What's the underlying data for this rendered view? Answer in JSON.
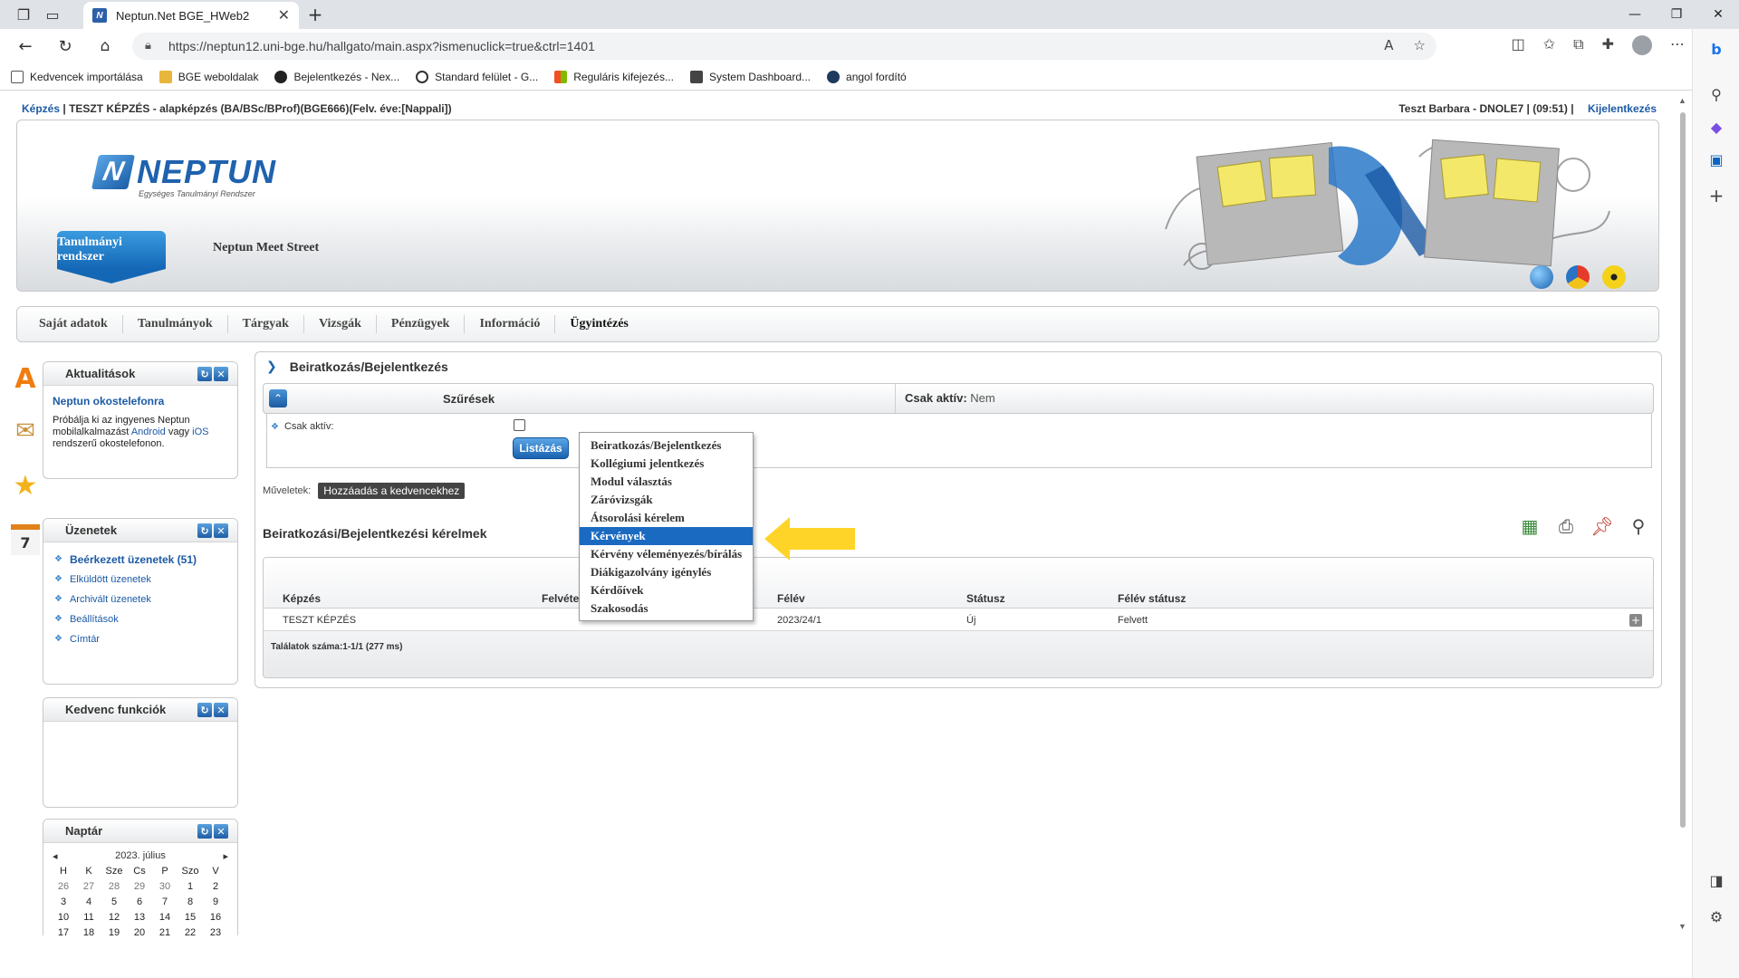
{
  "browser": {
    "tab_title": "Neptun.Net BGE_HWeb2",
    "url": "https://neptun12.uni-bge.hu/hallgato/main.aspx?ismenuclick=true&ctrl=1401",
    "favorites": [
      "Kedvencek importálása",
      "BGE weboldalak",
      "Bejelentkezés - Nex...",
      "Standard felület - G...",
      "Reguláris kifejezés...",
      "System Dashboard...",
      "angol fordító"
    ]
  },
  "header": {
    "training_label": "Képzés",
    "training_value": "TESZT KÉPZÉS - alapképzés (BA/BSc/BProf)(BGE666)(Felv. éve:[Nappali])",
    "user": "Teszt Barbara - DNOLE7",
    "timer": "(09:51)",
    "logout": "Kijelentkezés"
  },
  "banner": {
    "logo_text": "NEPTUN",
    "logo_sub": "Egységes Tanulmányi Rendszer",
    "tab_active": "Tanulmányi rendszer",
    "tab_other": "Neptun Meet Street"
  },
  "menu": [
    "Saját adatok",
    "Tanulmányok",
    "Tárgyak",
    "Vizsgák",
    "Pénzügyek",
    "Információ",
    "Ügyintézés"
  ],
  "dropdown": {
    "items": [
      "Beiratkozás/Bejelentkezés",
      "Kollégiumi jelentkezés",
      "Modul választás",
      "Záróvizsgák",
      "Átsorolási kérelem",
      "Kérvények",
      "Kérvény véleményezés/bírálás",
      "Diákigazolvány igénylés",
      "Kérdőívek",
      "Szakosodás"
    ],
    "selected_index": 5
  },
  "sidebar": {
    "news": {
      "title": "Aktualitások",
      "headline": "Neptun okostelefonra",
      "text_1": "Próbálja ki az ingyenes Neptun mobilalkalmazást",
      "link_android": "Android",
      "text_2": "vagy",
      "link_ios": "iOS",
      "text_3": "rendszerű okostelefonon."
    },
    "messages": {
      "title": "Üzenetek",
      "items": [
        "Beérkezett üzenetek (51)",
        "Elküldött üzenetek",
        "Archivált üzenetek",
        "Beállítások",
        "Címtár"
      ]
    },
    "favorites": {
      "title": "Kedvenc funkciók"
    },
    "calendar": {
      "title": "Naptár",
      "month": "2023. július",
      "weekdays": [
        "H",
        "K",
        "Sze",
        "Cs",
        "P",
        "Szo",
        "V"
      ],
      "weeks": [
        [
          "26",
          "27",
          "28",
          "29",
          "30",
          "1",
          "2"
        ],
        [
          "3",
          "4",
          "5",
          "6",
          "7",
          "8",
          "9"
        ],
        [
          "10",
          "11",
          "12",
          "13",
          "14",
          "15",
          "16"
        ],
        [
          "17",
          "18",
          "19",
          "20",
          "21",
          "22",
          "23"
        ]
      ],
      "side_day": "7",
      "side_letter": "A"
    }
  },
  "main": {
    "title": "Beiratkozás/Bejelentkezés",
    "filter": {
      "title": "Szűrések",
      "summary_label": "Csak aktív:",
      "summary_value": "Nem",
      "field_label": "Csak aktív:",
      "list_button": "Listázás"
    },
    "actions_label": "Műveletek:",
    "add_favorite": "Hozzáadás a kedvencekhez",
    "list_title": "Beiratkozási/Bejelentkezési kérelmek",
    "table": {
      "columns": [
        "Képzés",
        "Felvétel éve",
        "Félév",
        "Státusz",
        "Félév státusz"
      ],
      "rows": [
        [
          "TESZT KÉPZÉS",
          "",
          "2023/24/1",
          "Új",
          "Felvett"
        ]
      ],
      "count": "Találatok száma:1-1/1 (277 ms)"
    }
  },
  "colors": {
    "accent": "#1b6ac2",
    "arrow": "#ffd428",
    "link": "#1b5aa5"
  }
}
